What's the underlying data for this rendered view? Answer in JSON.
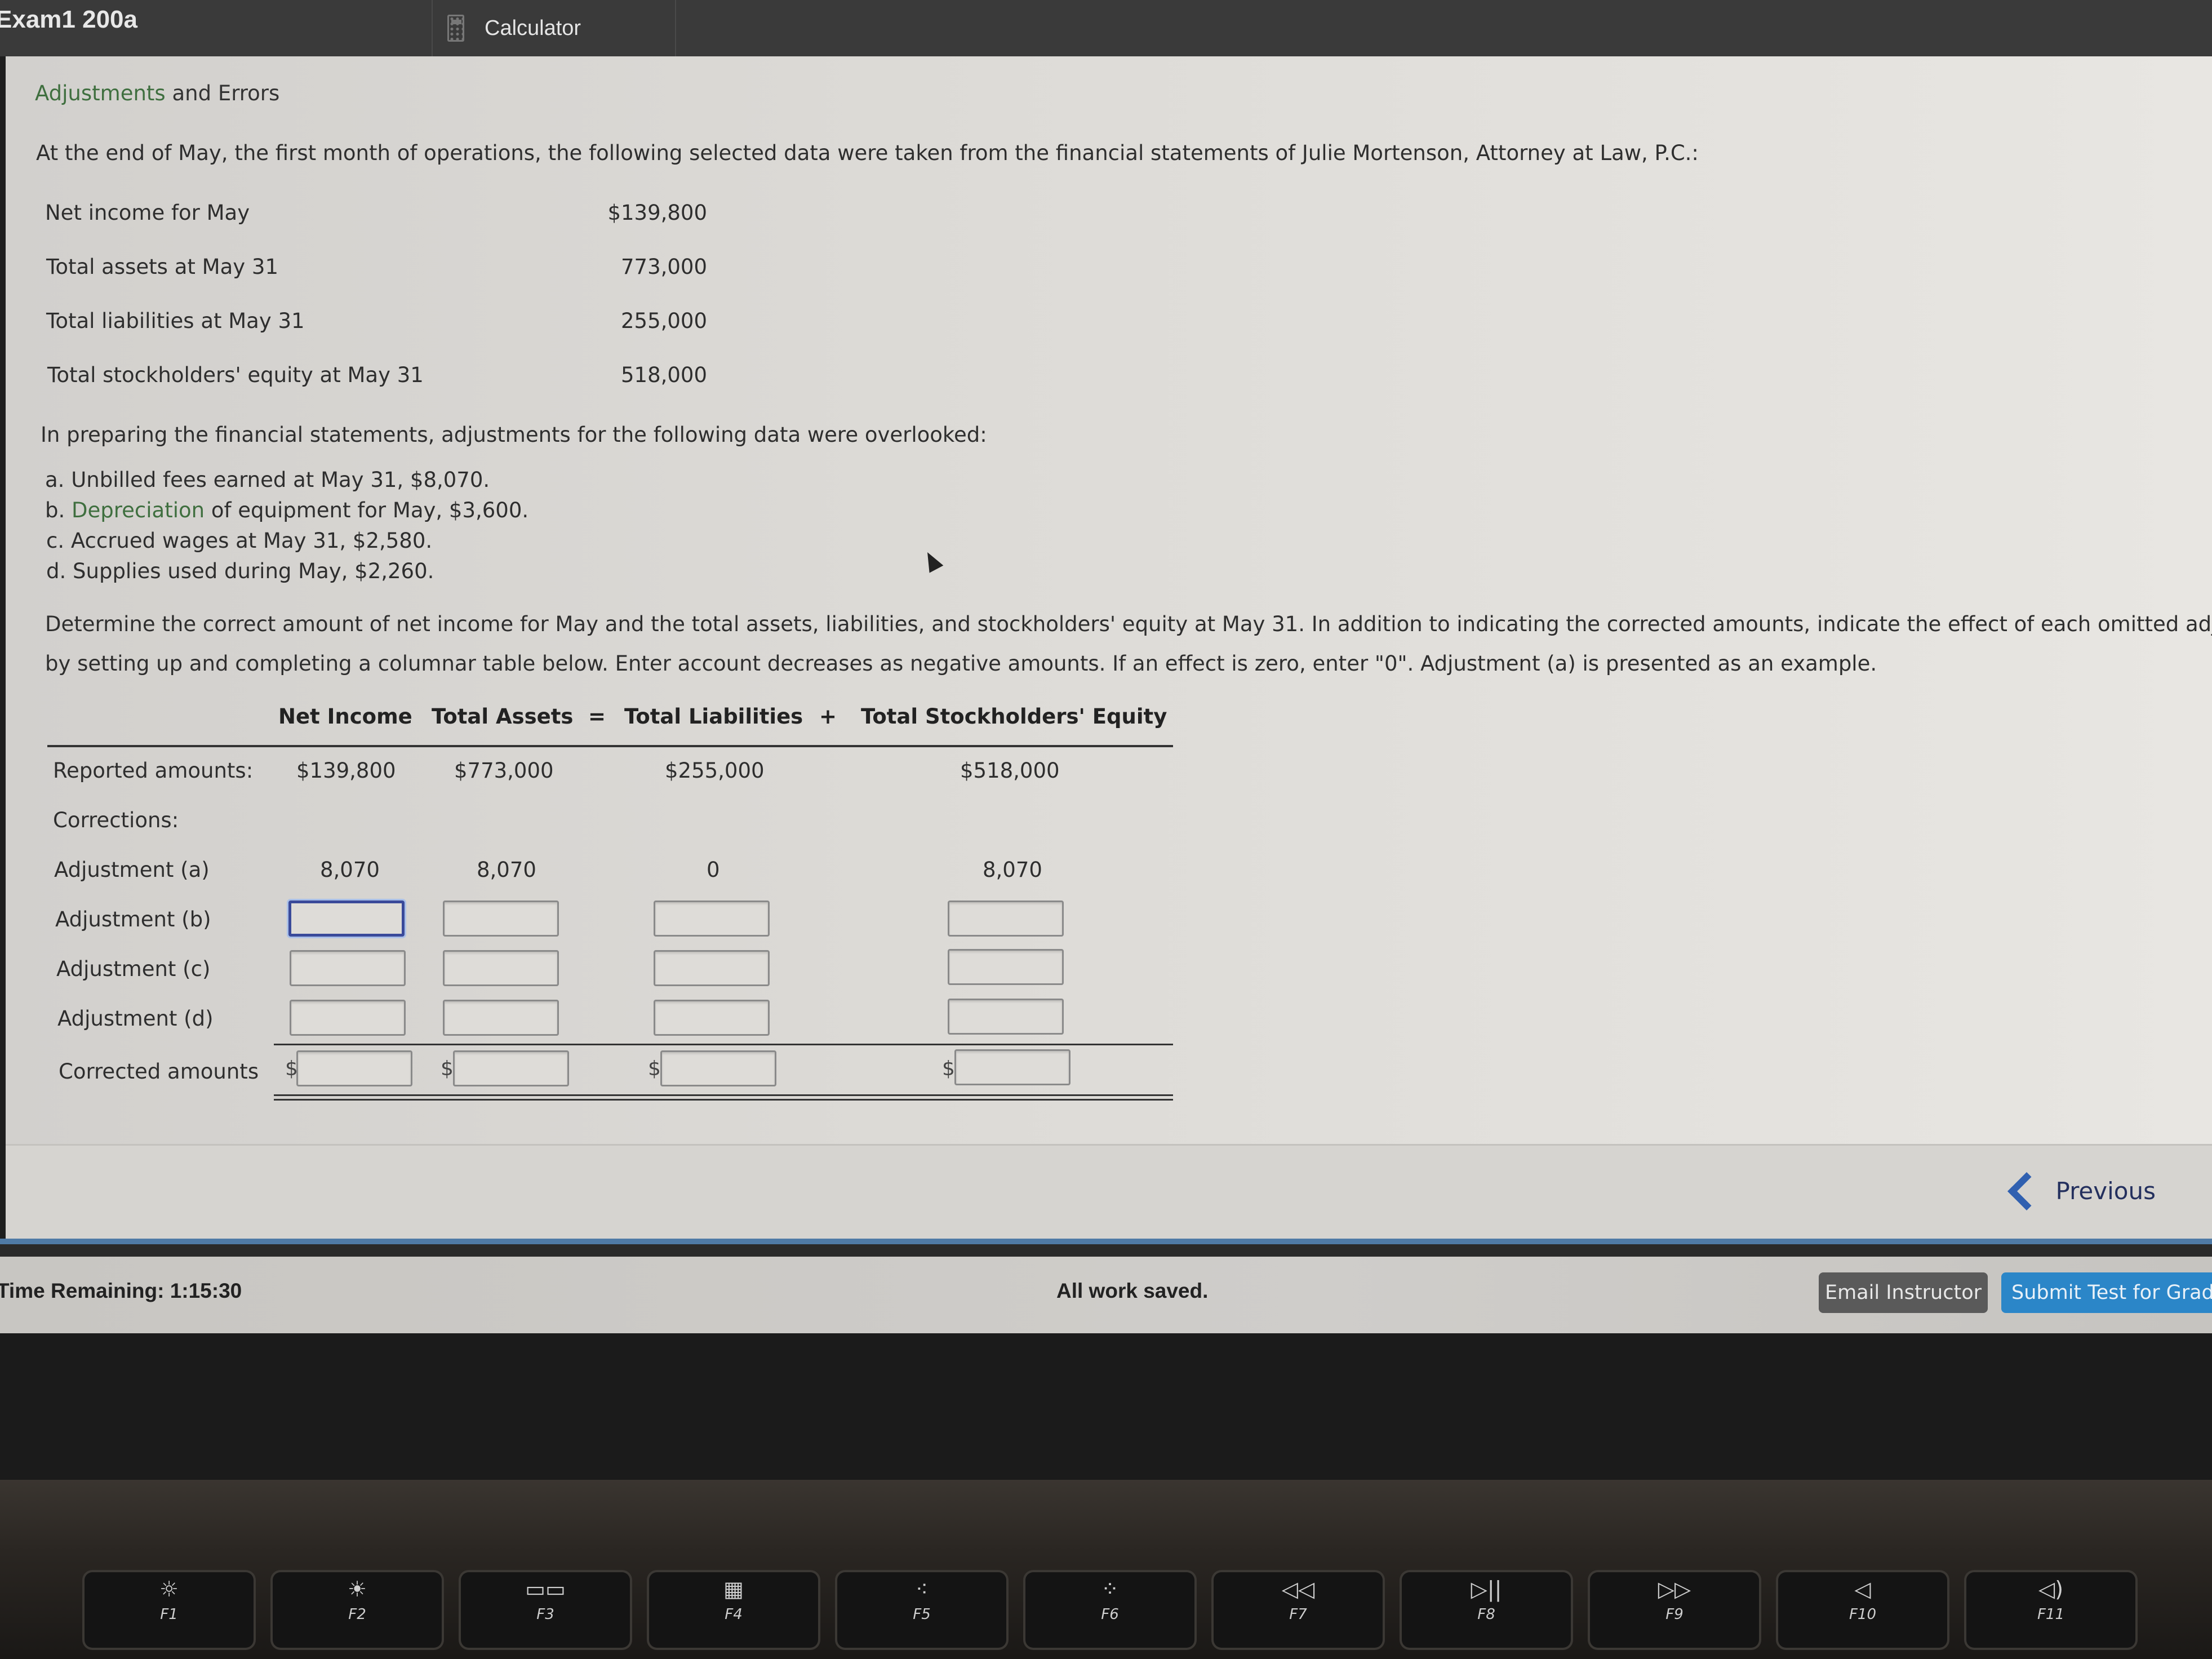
{
  "window": {
    "title": "Exam1 200a",
    "tools_tab": {
      "icon": "calculator-icon",
      "label": "Calculator"
    }
  },
  "problem": {
    "section_title_part1": "Adjustments",
    "section_title_part2": " and Errors",
    "intro": "At the end of May, the first month of operations, the following selected data were taken from the financial statements of Julie Mortenson, Attorney at Law, P.C.:",
    "selected_data": [
      {
        "label": "Net income for May",
        "value": "$139,800"
      },
      {
        "label": "Total assets at May 31",
        "value": "773,000"
      },
      {
        "label": "Total liabilities at May 31",
        "value": "255,000"
      },
      {
        "label": "Total stockholders' equity at May 31",
        "value": "518,000"
      }
    ],
    "overlooked_intro": "In preparing the financial statements, adjustments for the following data were overlooked:",
    "overlooked_items": [
      {
        "prefix": "a. ",
        "link": "",
        "text": "Unbilled fees earned at May 31, $8,070."
      },
      {
        "prefix": "b. ",
        "link": "Depreciation",
        "text": " of equipment for May, $3,600."
      },
      {
        "prefix": "c. ",
        "link": "",
        "text": "Accrued wages at May 31, $2,580."
      },
      {
        "prefix": "d. ",
        "link": "",
        "text": "Supplies used during May, $2,260."
      }
    ],
    "instructions_line1": "Determine the correct amount of net income for May and the total assets, liabilities, and stockholders' equity at May 31. In addition to indicating the corrected amounts, indicate the effect of each omitted adjustmen",
    "instructions_line2": "by setting up and completing a columnar table below. Enter account decreases as negative amounts. If an effect is zero, enter \"0\". Adjustment (a) is presented as an example."
  },
  "table": {
    "columns": [
      "Net Income",
      "Total Assets",
      "Total Liabilities",
      "Total Stockholders' Equity"
    ],
    "equals_sign": "=",
    "plus_sign": "+",
    "reported": {
      "label": "Reported amounts:",
      "values": [
        "$139,800",
        "$773,000",
        "$255,000",
        "$518,000"
      ]
    },
    "corrections_label": "Corrections:",
    "adjustment_a": {
      "label": "Adjustment (a)",
      "values": [
        "8,070",
        "8,070",
        "0",
        "8,070"
      ]
    },
    "input_rows": [
      {
        "label": "Adjustment (b)",
        "values": [
          "",
          "",
          "",
          ""
        ]
      },
      {
        "label": "Adjustment (c)",
        "values": [
          "",
          "",
          "",
          ""
        ]
      },
      {
        "label": "Adjustment (d)",
        "values": [
          "",
          "",
          "",
          ""
        ]
      }
    ],
    "corrected": {
      "label": "Corrected amounts",
      "currency": "$",
      "values": [
        "",
        "",
        "",
        ""
      ]
    }
  },
  "navigation": {
    "previous_label": "Previous"
  },
  "status": {
    "time_remaining": "Time Remaining: 1:15:30",
    "save_status": "All work saved.",
    "email_button": "Email Instructor",
    "submit_button": "Submit Test for Grading"
  },
  "keyboard": {
    "keys": [
      {
        "fn": "F1",
        "glyph": "☼"
      },
      {
        "fn": "F2",
        "glyph": "☀"
      },
      {
        "fn": "F3",
        "glyph": "▭▭"
      },
      {
        "fn": "F4",
        "glyph": "▦"
      },
      {
        "fn": "F5",
        "glyph": "⁖"
      },
      {
        "fn": "F6",
        "glyph": "⁘"
      },
      {
        "fn": "F7",
        "glyph": "◁◁"
      },
      {
        "fn": "F8",
        "glyph": "▷||"
      },
      {
        "fn": "F9",
        "glyph": "▷▷"
      },
      {
        "fn": "F10",
        "glyph": "◁"
      },
      {
        "fn": "F11",
        "glyph": "◁)"
      }
    ]
  }
}
